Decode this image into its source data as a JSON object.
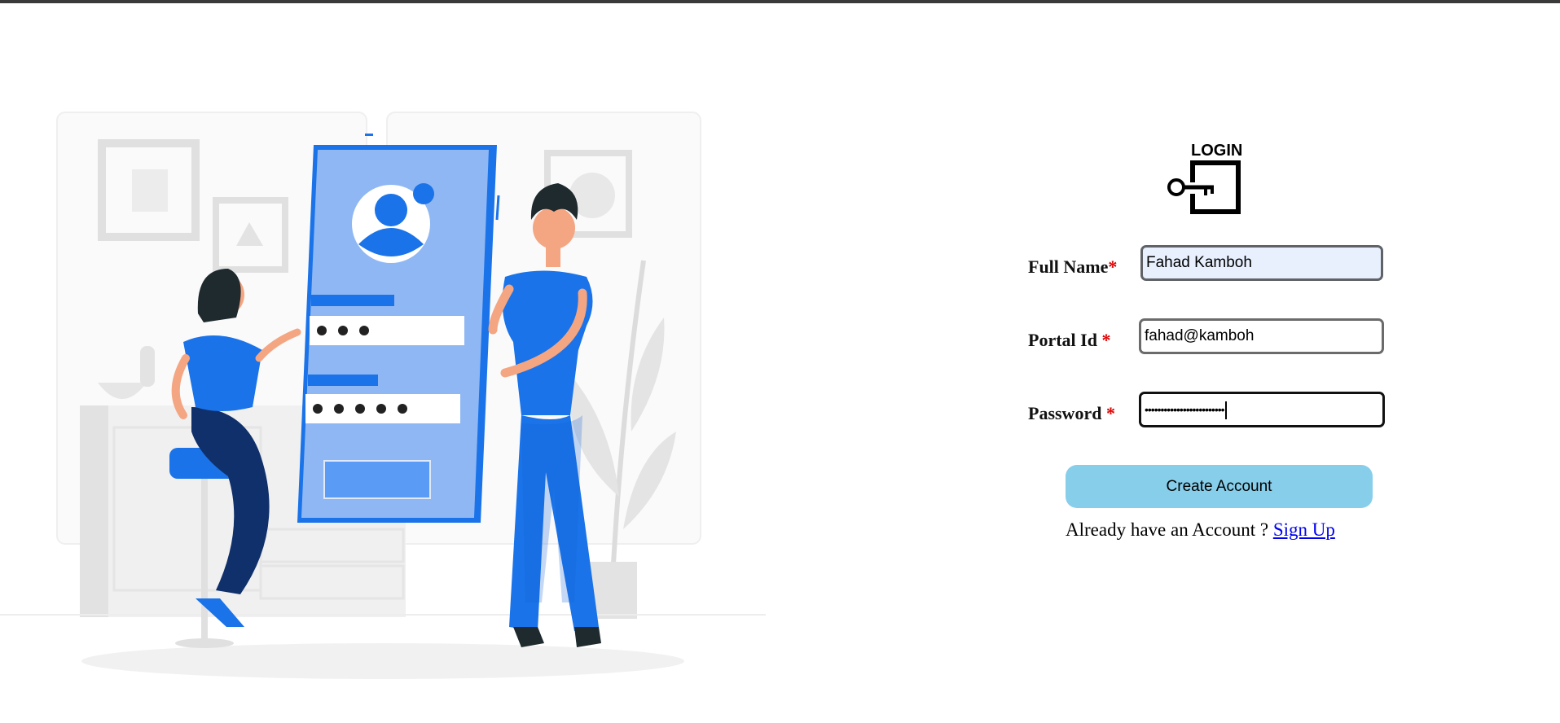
{
  "logo": {
    "text": "LOGIN",
    "icon": "key-door-icon"
  },
  "form": {
    "fields": [
      {
        "label": "Full Name",
        "required_mark": "*",
        "value": "Fahad Kamboh"
      },
      {
        "label": "Portal Id",
        "required_mark": "*",
        "value": "fahad@kamboh"
      },
      {
        "label": "Password",
        "required_mark": "*",
        "value": "•••••••••••••••••••••••••"
      }
    ],
    "submit_label": "Create Account",
    "already_text": "Already have an Account ? ",
    "signup_link": "Sign Up"
  },
  "illustration": {
    "name": "login-illustration"
  },
  "colors": {
    "accent_blue": "#1a73e8",
    "button_bg": "#87ceeb",
    "required": "#e00000",
    "link": "#0000ee"
  }
}
